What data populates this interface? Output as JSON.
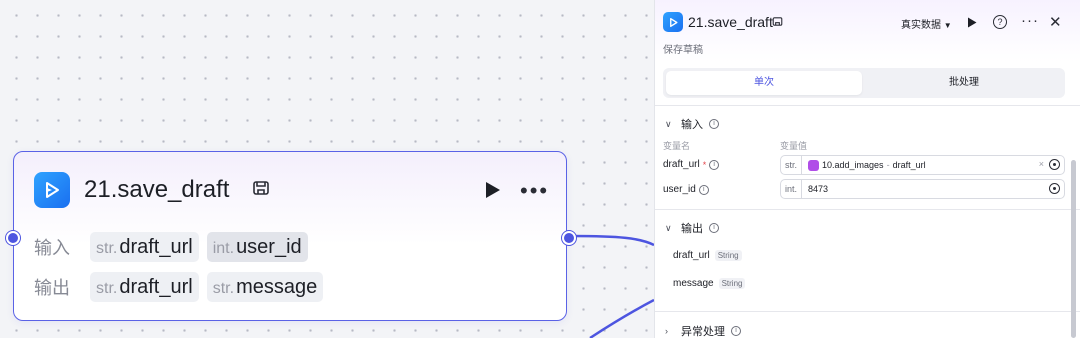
{
  "canvas": {
    "node": {
      "title": "21.save_draft",
      "input_label": "输入",
      "output_label": "输出",
      "inputs": [
        {
          "type": "str.",
          "name": "draft_url"
        },
        {
          "type": "int.",
          "name": "user_id"
        }
      ],
      "outputs": [
        {
          "type": "str.",
          "name": "draft_url"
        },
        {
          "type": "str.",
          "name": "message"
        }
      ]
    },
    "edge_color": "#4d55e0"
  },
  "panel": {
    "title": "21.save_draft",
    "subtitle": "保存草稿",
    "data_mode": "真实数据",
    "tabs": [
      "单次",
      "批处理"
    ],
    "input_section": "输入",
    "col_name": "变量名",
    "col_value": "变量值",
    "inputs": [
      {
        "name": "draft_url",
        "required": "*",
        "type": "str.",
        "ref_node": "10.add_images",
        "ref_sep": "-",
        "ref_field": "draft_url"
      },
      {
        "name": "user_id",
        "required": "",
        "type": "int.",
        "value": "8473"
      }
    ],
    "output_section": "输出",
    "outputs": [
      {
        "name": "draft_url",
        "type": "String"
      },
      {
        "name": "message",
        "type": "String"
      }
    ],
    "exception_section": "异常处理",
    "accent": "#4d55e0"
  }
}
